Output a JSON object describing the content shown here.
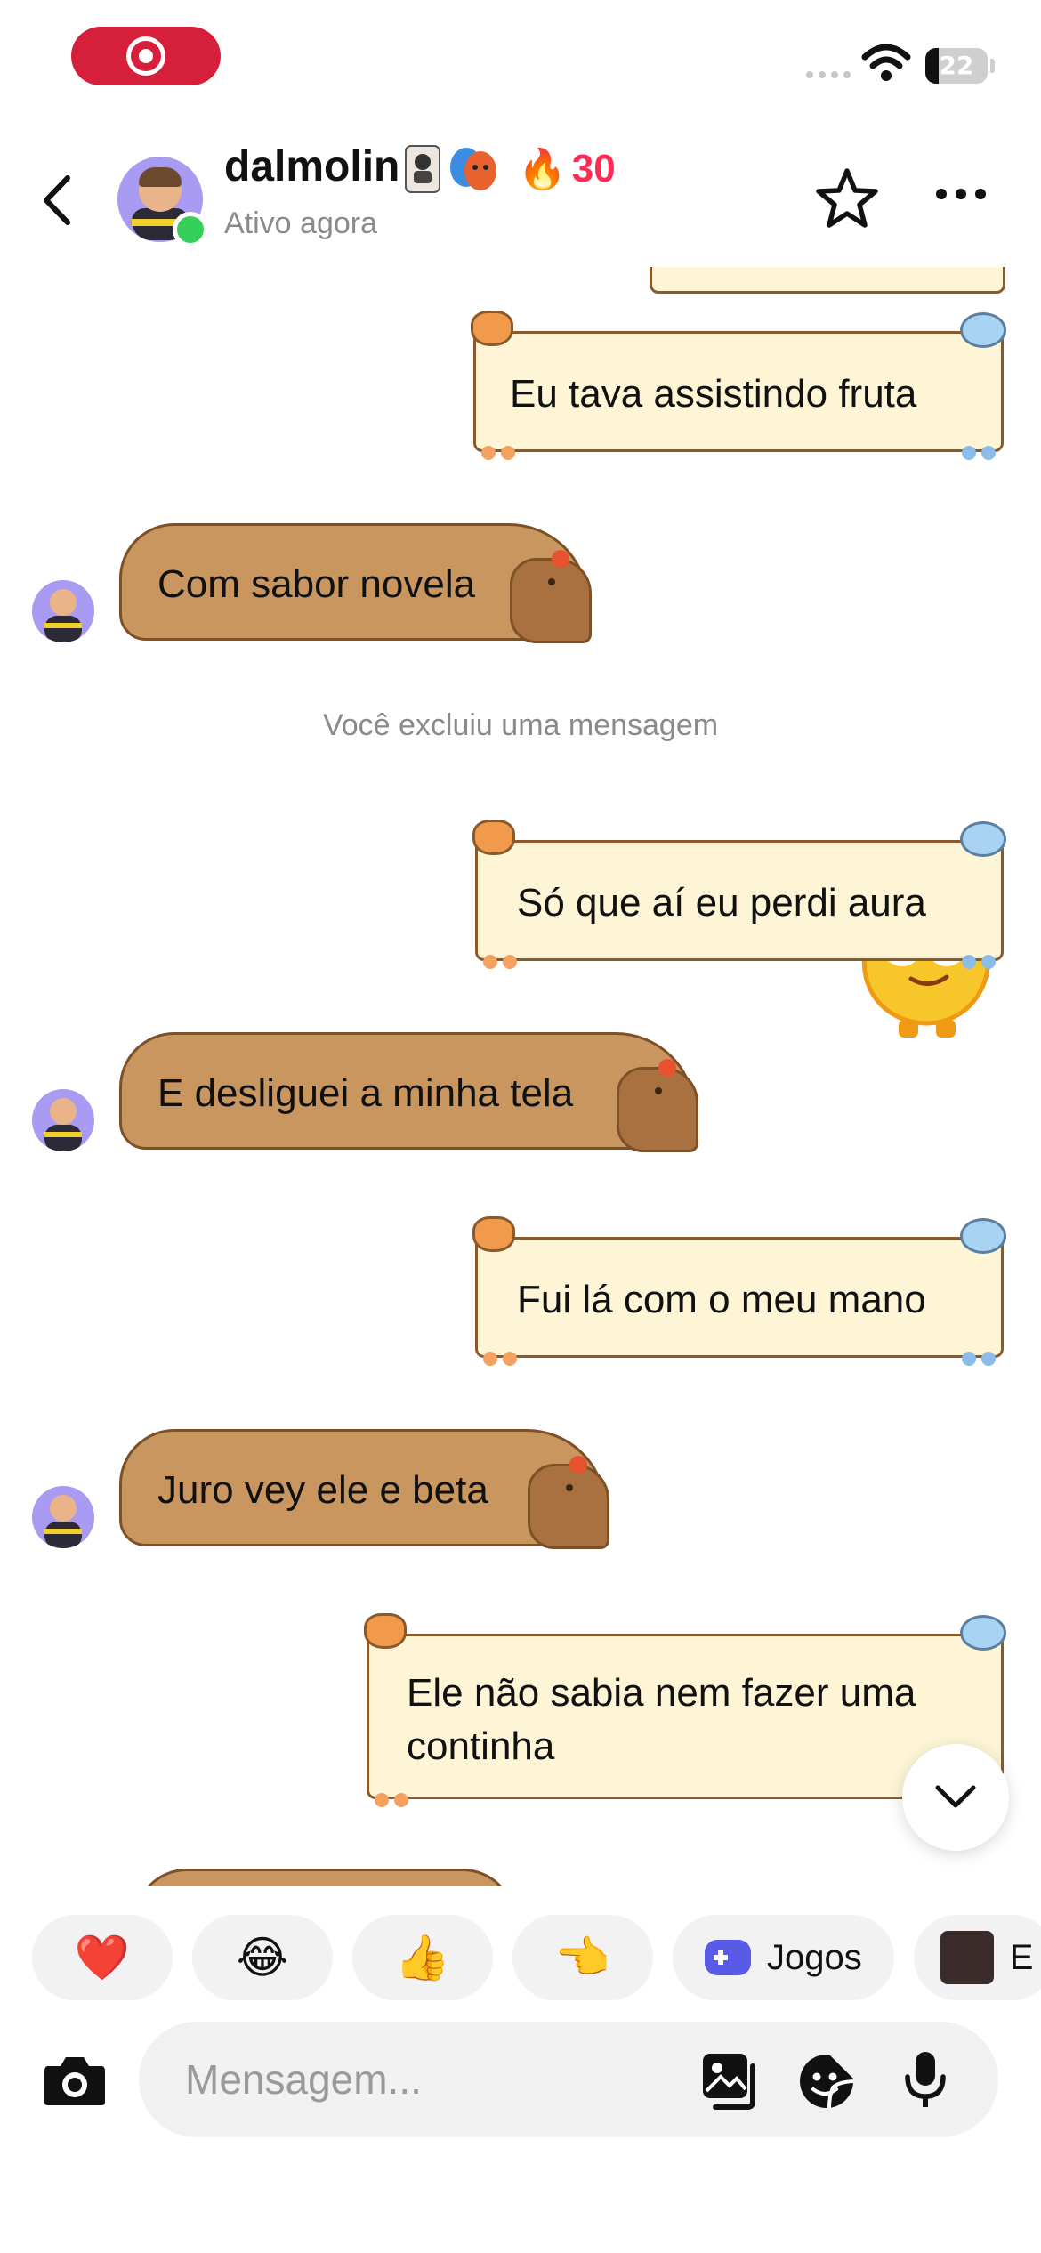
{
  "status_bar": {
    "battery_level": "22",
    "battery_fraction": 0.22,
    "recording_color": "#d61f3b"
  },
  "header": {
    "name": "dalmolin",
    "status": "Ativo agora",
    "streak_count": "30",
    "streak_icon": "fire-icon",
    "badges": [
      "jester-card-badge",
      "theater-masks-badge"
    ]
  },
  "messages": [
    {
      "side": "sent",
      "text": "Eu tava assistindo fruta"
    },
    {
      "side": "received",
      "text": "Com sabor novela"
    },
    {
      "side": "system",
      "text": "Você excluiu uma mensagem"
    },
    {
      "side": "sent",
      "text": "Só que aí eu perdi aura"
    },
    {
      "side": "received",
      "text": "E desliguei a minha tela"
    },
    {
      "side": "sent",
      "text": "Fui lá com o meu mano"
    },
    {
      "side": "received",
      "text": "Juro vey ele e beta"
    },
    {
      "side": "sent",
      "text_line1": "Ele não sabia nem fazer uma",
      "text_line2": "continha"
    }
  ],
  "quick_reactions": [
    {
      "emoji": "❤️"
    },
    {
      "emoji": "😂"
    },
    {
      "emoji": "👍"
    },
    {
      "emoji": "👈"
    },
    {
      "label": "Jogos",
      "icon": "gamepad-icon"
    },
    {
      "label": "E"
    }
  ],
  "composer": {
    "placeholder": "Mensagem..."
  },
  "colors": {
    "accent": "#fe2c55",
    "online": "#35d05a",
    "sent_bubble": "#fdf5d6",
    "received_bubble": "#c99660"
  }
}
